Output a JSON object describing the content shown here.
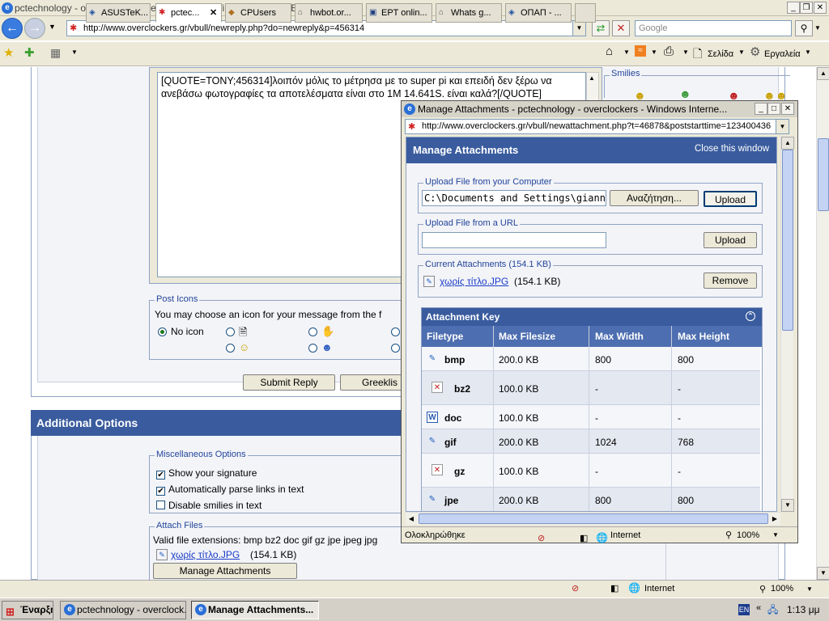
{
  "browser": {
    "title": "pctechnology - overclockers - Reply to Topic - Windows Internet Explorer",
    "url": "http://www.overclockers.gr/vbull/newreply.php?do=newreply&p=456314",
    "search_placeholder": "Google",
    "tabs": [
      {
        "label": "ASUSTeK..."
      },
      {
        "label": "pctec..."
      },
      {
        "label": "CPUsers"
      },
      {
        "label": "hwbot.or..."
      },
      {
        "label": "EPT onlin..."
      },
      {
        "label": "Whats g..."
      },
      {
        "label": "ΟΠΑΠ - ..."
      }
    ],
    "toolbar": {
      "page_label": "Σελίδα",
      "tools_label": "Εργαλεία"
    },
    "status": {
      "zone": "Internet",
      "zoom": "100%"
    }
  },
  "page": {
    "editor_text": "[QUOTE=TONY;456314]λοιπόν μόλις το μέτρησα με το super pi και επειδή δεν ξέρω να ανεβάσω φωτογραφίες τα αποτελέσματα είναι στο 1M 14.641S. είναι καλά?[/QUOTE]",
    "smilies_label": "Smilies",
    "post_icons": {
      "legend": "Post Icons",
      "description": "You may choose an icon for your message from the f",
      "no_icon": "No icon"
    },
    "submit_label": "Submit Reply",
    "greeklish_label": "Greeklis",
    "additional_options": {
      "heading": "Additional Options",
      "misc_legend": "Miscellaneous Options",
      "options": [
        {
          "label": "Show your signature",
          "checked": true
        },
        {
          "label": "Automatically parse links in text",
          "checked": true
        },
        {
          "label": "Disable smilies in text",
          "checked": false
        }
      ],
      "attach_legend": "Attach Files",
      "valid_ext": "Valid file extensions: bmp bz2 doc gif gz jpe jpeg jpg",
      "file_name": "χωρίς τίτλο.JPG",
      "file_size": "(154.1 KB)",
      "manage_btn": "Manage Attachments"
    }
  },
  "popup": {
    "title": "Manage Attachments - pctechnology - overclockers - Windows Interne...",
    "url": "http://www.overclockers.gr/vbull/newattachment.php?t=46878&poststarttime=123400436",
    "header": "Manage Attachments",
    "close_link": "Close this window",
    "upload_computer": {
      "legend": "Upload File from your Computer",
      "value": "C:\\Documents and Settings\\giann",
      "browse": "Αναζήτηση...",
      "upload": "Upload"
    },
    "upload_url": {
      "legend": "Upload File from a URL",
      "value": "",
      "upload": "Upload"
    },
    "current": {
      "legend": "Current Attachments (154.1 KB)",
      "file_name": "χωρίς τίτλο.JPG",
      "file_size": "(154.1 KB)",
      "remove": "Remove"
    },
    "key": {
      "title": "Attachment Key",
      "headers": [
        "Filetype",
        "Max Filesize",
        "Max Width",
        "Max Height"
      ],
      "rows": [
        {
          "type": "bmp",
          "size": "200.0 KB",
          "width": "800",
          "height": "800",
          "icon": "image-icon"
        },
        {
          "type": "bz2",
          "size": "100.0 KB",
          "width": "-",
          "height": "-",
          "icon": "broken-image-icon"
        },
        {
          "type": "doc",
          "size": "100.0 KB",
          "width": "-",
          "height": "-",
          "icon": "word-doc-icon"
        },
        {
          "type": "gif",
          "size": "200.0 KB",
          "width": "1024",
          "height": "768",
          "icon": "image-icon"
        },
        {
          "type": "gz",
          "size": "100.0 KB",
          "width": "-",
          "height": "-",
          "icon": "broken-image-icon"
        },
        {
          "type": "jpe",
          "size": "200.0 KB",
          "width": "800",
          "height": "800",
          "icon": "image-icon"
        }
      ]
    },
    "status": {
      "text": "Ολοκληρώθηκε",
      "zone": "Internet",
      "zoom": "100%"
    }
  },
  "taskbar": {
    "start": "Έναρξη",
    "buttons": [
      {
        "label": "pctechnology - overclock..."
      },
      {
        "label": "Manage Attachments..."
      }
    ],
    "lang": "EN",
    "clock": "1:13 μμ"
  },
  "colors": {
    "accent_blue": "#3a5c9e",
    "link": "#1a3cc8",
    "xp_chrome": "#ece9d8"
  }
}
